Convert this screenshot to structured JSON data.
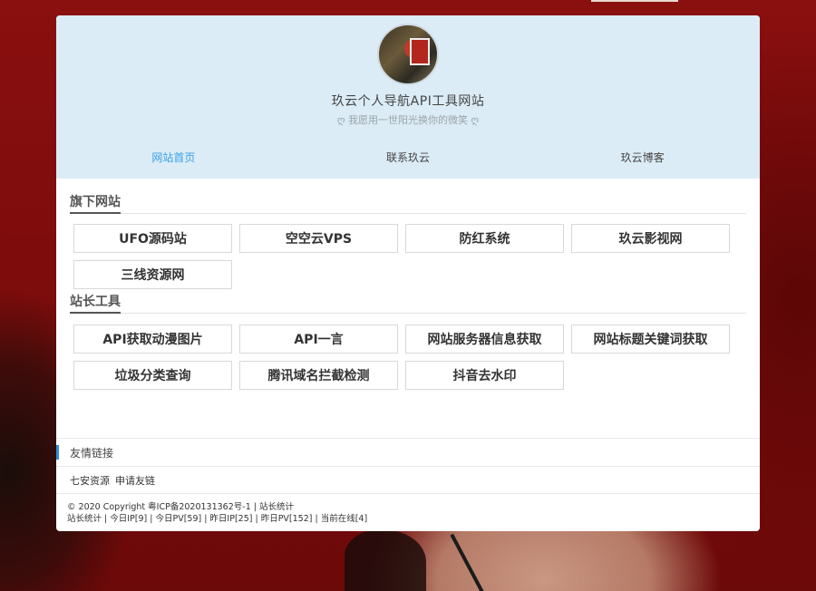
{
  "site": {
    "title": "玖云个人导航API工具网站",
    "slogan": "ღ 我愿用一世阳光换你的微笑 ღ"
  },
  "nav": {
    "items": [
      {
        "label": "网站首页",
        "active": true
      },
      {
        "label": "联系玖云",
        "active": false
      },
      {
        "label": "玖云博客",
        "active": false
      }
    ]
  },
  "sites": {
    "title": "旗下网站",
    "items": [
      "UFO源码站",
      "空空云VPS",
      "防红系统",
      "玖云影视网",
      "三线资源网"
    ]
  },
  "tools": {
    "title": "站长工具",
    "items": [
      "API获取动漫图片",
      "API一言",
      "网站服务器信息获取",
      "网站标题关键词获取",
      "垃圾分类查询",
      "腾讯域名拦截检测",
      "抖音去水印"
    ]
  },
  "friends": {
    "title": "友情链接",
    "links": [
      "七安资源",
      "申请友链"
    ]
  },
  "footer": {
    "line1": "© 2020 Copyright  粤ICP备2020131362号-1 |  站长统计",
    "line2": "站长统计 | 今日IP[9] | 今日PV[59] | 昨日IP[25] | 昨日PV[152] | 当前在线[4]"
  },
  "colors": {
    "header_bg": "#dbecf6",
    "accent": "#3aa0e8",
    "page_bg": "#7a0b0b"
  }
}
